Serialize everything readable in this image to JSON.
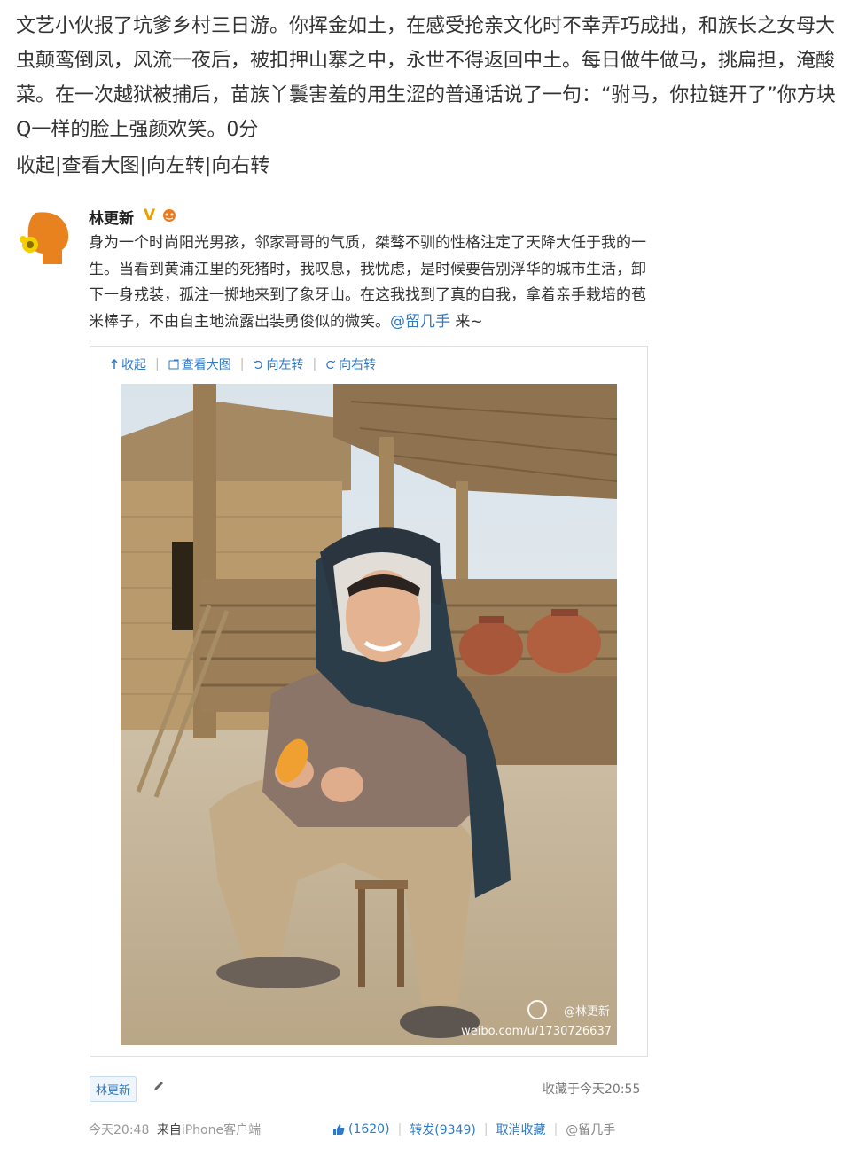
{
  "top_comment": {
    "text": "文艺小伙报了坑爹乡村三日游。你挥金如土，在感受抢亲文化时不幸弄巧成拙，和族长之女母大虫颠鸾倒凤，风流一夜后，被扣押山寨之中，永世不得返回中土。每日做牛做马，挑扁担，淹酸菜。在一次越狱被捕后，苗族丫鬟害羞的用生涩的普通话说了一句：“驸马，你拉链开了”你方块Q一样的脸上强颜欢笑。0分",
    "actions": [
      "收起",
      "查看大图",
      "向左转",
      "向右转"
    ],
    "separator": "|"
  },
  "post": {
    "username": "林更新",
    "verified_badge": "V",
    "text": "身为一个时尚阳光男孩，邻家哥哥的气质，桀骜不驯的性格注定了天降大任于我的一生。当看到黄浦江里的死猪时，我叹息，我忧虑，是时候要告别浮华的城市生活，卸下一身戎装，孤注一掷地来到了象牙山。在这我找到了真的自我，拿着亲手栽培的苞米棒子，不由自主地流露出装勇俊似的微笑。",
    "mention": "@留几手",
    "trailing": " 来~",
    "media_actions": [
      {
        "icon": "collapse-icon",
        "label": "收起"
      },
      {
        "icon": "view-large-icon",
        "label": "查看大图"
      },
      {
        "icon": "rotate-left-icon",
        "label": "向左转"
      },
      {
        "icon": "rotate-right-icon",
        "label": "向右转"
      }
    ],
    "watermark_handle": "@林更新",
    "watermark_url": "weibo.com/u/1730726637",
    "tag": "林更新",
    "fav_time": "收藏于今天20:55",
    "footer": {
      "time": "今天20:48",
      "from_prefix": "来自",
      "client": "iPhone客户端",
      "like_count": "(1620)",
      "repost": "转发(9349)",
      "unfavorite": "取消收藏",
      "comment_watermark": "@留几手"
    }
  },
  "colors": {
    "link": "#2f79c6",
    "badge": "#e8a200",
    "text": "#333333"
  }
}
